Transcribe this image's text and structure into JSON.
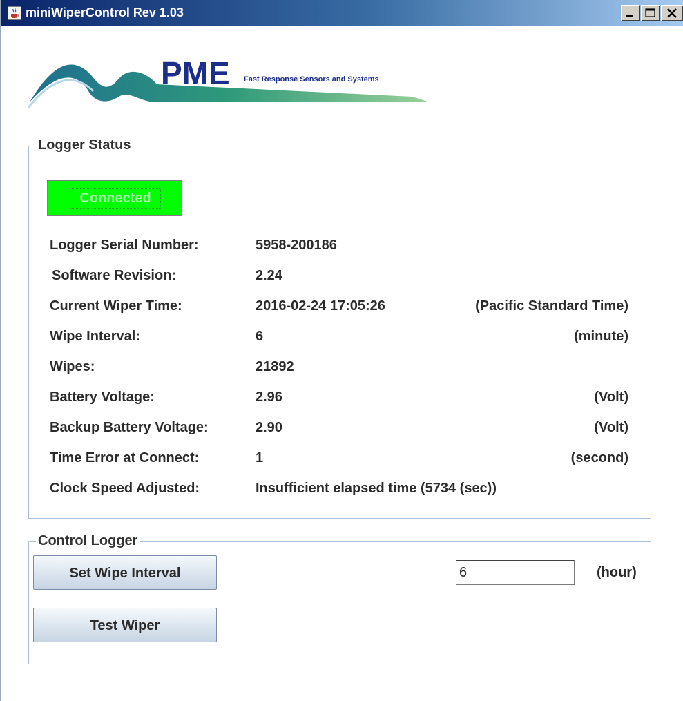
{
  "window": {
    "title": "miniWiperControl Rev 1.03",
    "controls": {
      "minimize_icon": "minimize-icon",
      "maximize_icon": "maximize-icon",
      "close_icon": "close-icon"
    }
  },
  "logo": {
    "brand": "PME",
    "tagline": "Fast Response Sensors and Systems"
  },
  "status": {
    "legend": "Logger Status",
    "connection": "Connected",
    "rows": [
      {
        "label": "Logger Serial Number:",
        "value": "5958-200186",
        "unit": ""
      },
      {
        "label": "Software Revision:",
        "value": "2.24",
        "unit": ""
      },
      {
        "label": "Current Wiper Time:",
        "value": "2016-02-24 17:05:26",
        "unit": "(Pacific Standard Time)"
      },
      {
        "label": "Wipe Interval:",
        "value": "6",
        "unit": "(minute)"
      },
      {
        "label": "Wipes:",
        "value": "21892",
        "unit": ""
      },
      {
        "label": "Battery Voltage:",
        "value": "2.96",
        "unit": "(Volt)"
      },
      {
        "label": "Backup Battery Voltage:",
        "value": "2.90",
        "unit": "(Volt)"
      },
      {
        "label": "Time Error at Connect:",
        "value": "1",
        "unit": "(second)"
      },
      {
        "label": "Clock Speed Adjusted:",
        "value": "Insufficient elapsed time (5734 (sec))",
        "unit": ""
      }
    ]
  },
  "control": {
    "legend": "Control Logger",
    "set_interval_label": "Set Wipe  Interval",
    "interval_value": "6",
    "interval_unit": "(hour)",
    "test_wiper_label": "Test Wiper"
  },
  "colors": {
    "connected_bg": "#00ff00",
    "titlebar_start": "#0a246a",
    "titlebar_end": "#a6caf0",
    "logo_blue": "#1a3a8a",
    "logo_wave_green": "#3aa46a",
    "logo_wave_teal": "#1f6f8f"
  }
}
